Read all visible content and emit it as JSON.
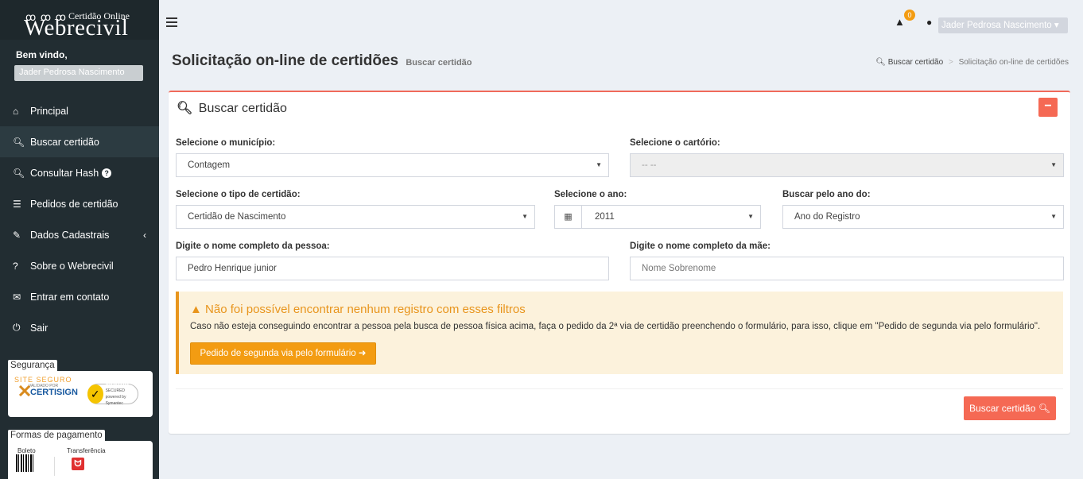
{
  "logo": {
    "dots": "ꝏ ꝏ ꝏ",
    "subtitle": "Certidão Online",
    "title": "Webrecivil"
  },
  "welcome": {
    "title": "Bem vindo,",
    "name": "Jader Pedrosa Nascimento"
  },
  "menu": [
    {
      "label": "Principal",
      "icon": "home-icon"
    },
    {
      "label": "Buscar certidão",
      "icon": "search-icon"
    },
    {
      "label": "Consultar Hash",
      "icon": "search-icon"
    },
    {
      "label": "Pedidos de certidão",
      "icon": "list-icon"
    },
    {
      "label": "Dados Cadastrais",
      "icon": "edit-icon"
    },
    {
      "label": "Sobre o Webrecivil",
      "icon": "question-icon"
    },
    {
      "label": "Entrar em contato",
      "icon": "envelope-icon"
    },
    {
      "label": "Sair",
      "icon": "power-icon"
    }
  ],
  "seguranca": {
    "label": "Segurança",
    "certisign_line1": "SITE SEGURO",
    "certisign_line2": "VALIDADO POR",
    "certisign_line3": "CERTISIGN",
    "norton_line1": "Norton",
    "norton_line2": "SECURED",
    "norton_line3": "powered by Symantec"
  },
  "pagamento": {
    "label": "Formas de pagamento",
    "boleto": "Boleto",
    "transferencia": "Transferência"
  },
  "header": {
    "notification_count": "0",
    "user_name": "Jader Pedrosa Nascimento"
  },
  "page": {
    "title": "Solicitação on-line de certidões",
    "subtitle": "Buscar certidão",
    "breadcrumb_link": "Buscar certidão",
    "breadcrumb_current": "Solicitação on-line de certidões"
  },
  "box": {
    "title": "Buscar certidão",
    "municipio_label": "Selecione o município:",
    "municipio_value": "Contagem",
    "cartorio_label": "Selecione o cartório:",
    "cartorio_value": "-- --",
    "tipo_label": "Selecione o tipo de certidão:",
    "tipo_value": "Certidão de Nascimento",
    "ano_label": "Selecione o ano:",
    "ano_value": "2011",
    "buscar_ano_label": "Buscar pelo ano do:",
    "buscar_ano_value": "Ano do Registro",
    "pessoa_label": "Digite o nome completo da pessoa:",
    "pessoa_value": "Pedro Henrique junior",
    "mae_label": "Digite o nome completo da mãe:",
    "mae_placeholder": "Nome Sobrenome",
    "warning_title": "Não foi possível encontrar nenhum registro com esses filtros",
    "warning_text": "Caso não esteja conseguindo encontrar a pessoa pela busca de pessoa física acima, faça o pedido da 2ª via de certidão preenchendo o formulário, para isso, clique em \"Pedido de segunda via pelo formulário\".",
    "warning_button": "Pedido de segunda via pelo formulário",
    "search_button": "Buscar certidão"
  }
}
